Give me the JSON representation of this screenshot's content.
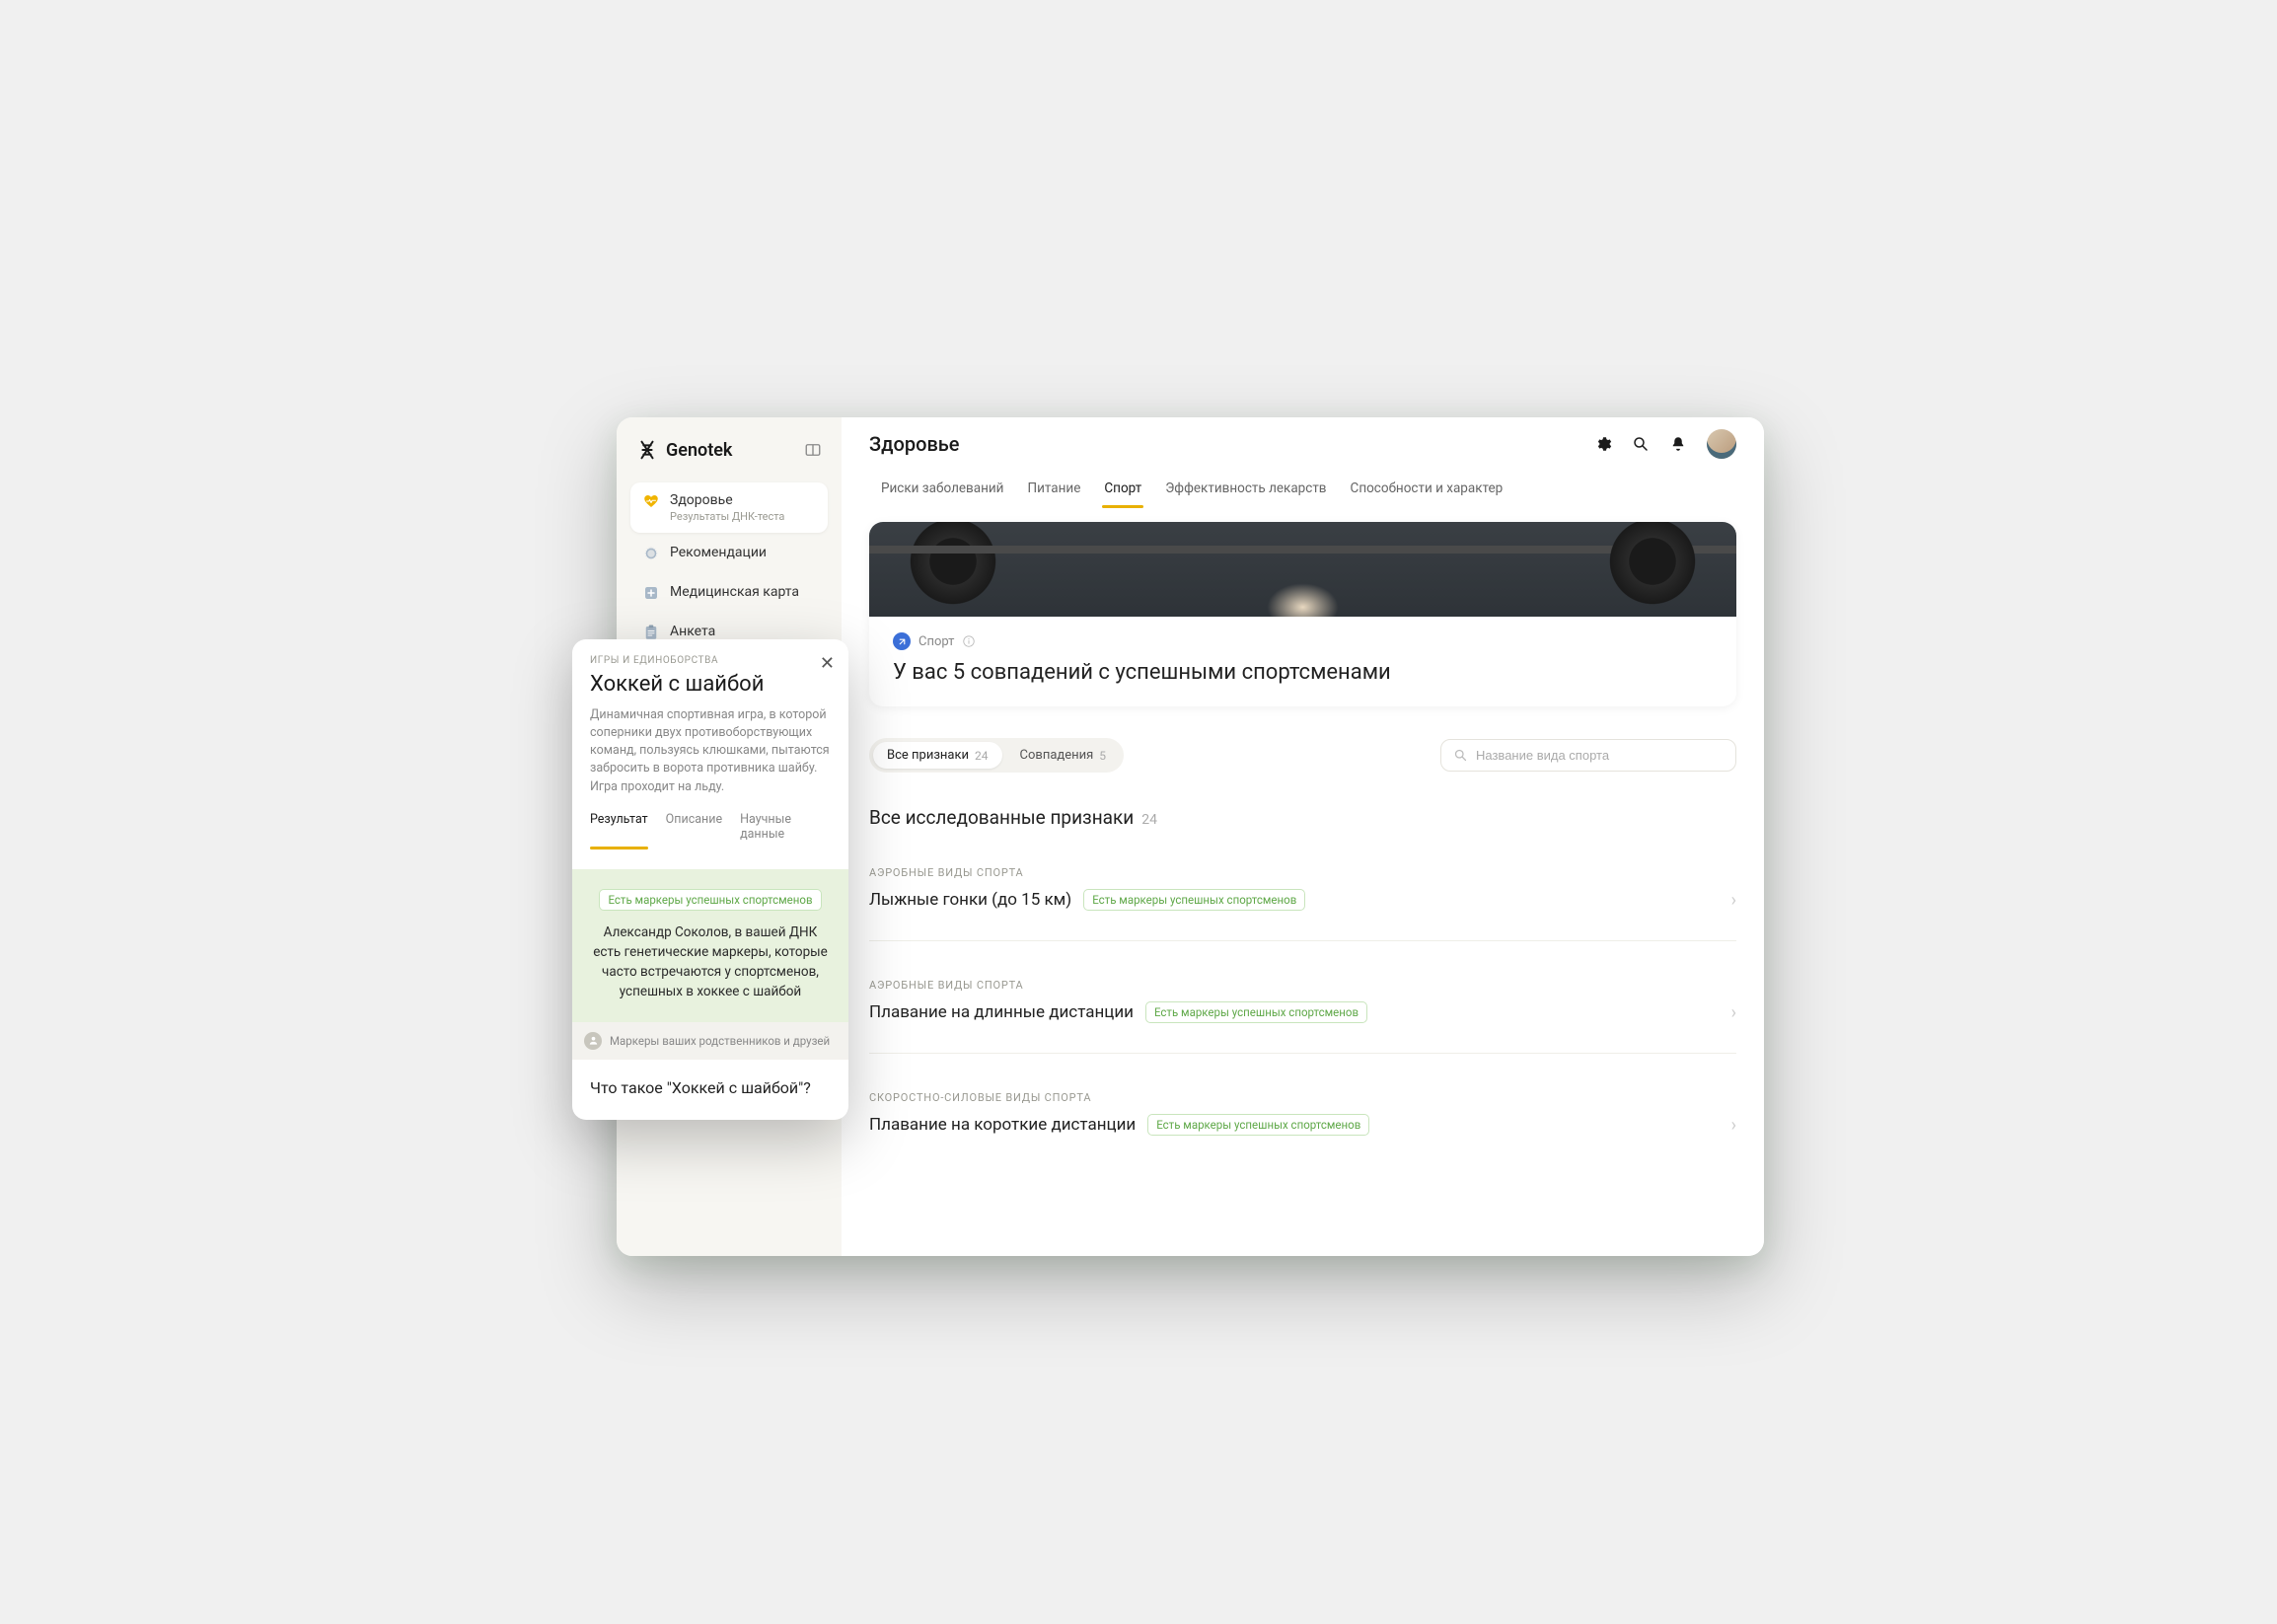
{
  "brand": "Genotek",
  "sidebar": {
    "items": [
      {
        "label": "Здоровье",
        "sub": "Результаты ДНК-теста",
        "icon": "heart"
      },
      {
        "label": "Рекомендации",
        "icon": "badge"
      },
      {
        "label": "Медицинская карта",
        "icon": "med"
      },
      {
        "label": "Анкета",
        "icon": "clipboard"
      }
    ]
  },
  "header": {
    "title": "Здоровье"
  },
  "tabs": [
    {
      "label": "Риски заболеваний"
    },
    {
      "label": "Питание"
    },
    {
      "label": "Спорт",
      "active": true
    },
    {
      "label": "Эффективность лекарств"
    },
    {
      "label": "Способности и характер"
    }
  ],
  "hero": {
    "badge": "Спорт",
    "title": "У вас 5 совпадений с успешными спортсменами"
  },
  "filters": {
    "pills": [
      {
        "label": "Все признаки",
        "count": "24",
        "active": true
      },
      {
        "label": "Совпадения",
        "count": "5"
      }
    ],
    "search_placeholder": "Название вида спорта"
  },
  "section": {
    "title": "Все исследованные признаки",
    "count": "24"
  },
  "badge_marker": "Есть маркеры успешных спортсменов",
  "traits": [
    {
      "category": "АЭРОБНЫЕ ВИДЫ СПОРТА",
      "name": "Лыжные гонки (до 15 км)"
    },
    {
      "category": "АЭРОБНЫЕ ВИДЫ СПОРТА",
      "name": "Плавание на длинные дистанции"
    },
    {
      "category": "СКОРОСТНО-СИЛОВЫЕ ВИДЫ СПОРТА",
      "name": "Плавание на короткие дистанции"
    }
  ],
  "modal": {
    "category": "ИГРЫ И ЕДИНОБОРСТВА",
    "title": "Хоккей с шайбой",
    "desc": "Динамичная спортивная игра, в которой соперники двух противоборствующих команд, пользуясь клюшками, пытаются забросить в ворота противника шайбу. Игра проходит на льду.",
    "tabs": [
      {
        "label": "Результат",
        "active": true
      },
      {
        "label": "Описание"
      },
      {
        "label": "Научные данные"
      }
    ],
    "result_text": "Александр Соколов, в вашей ДНК есть генетические маркеры, которые часто встречаются у спортсменов, успешных в хоккее с шайбой",
    "relatives": "Маркеры ваших родственников и друзей",
    "what_title": "Что такое \"Хоккей с шайбой\"?"
  }
}
